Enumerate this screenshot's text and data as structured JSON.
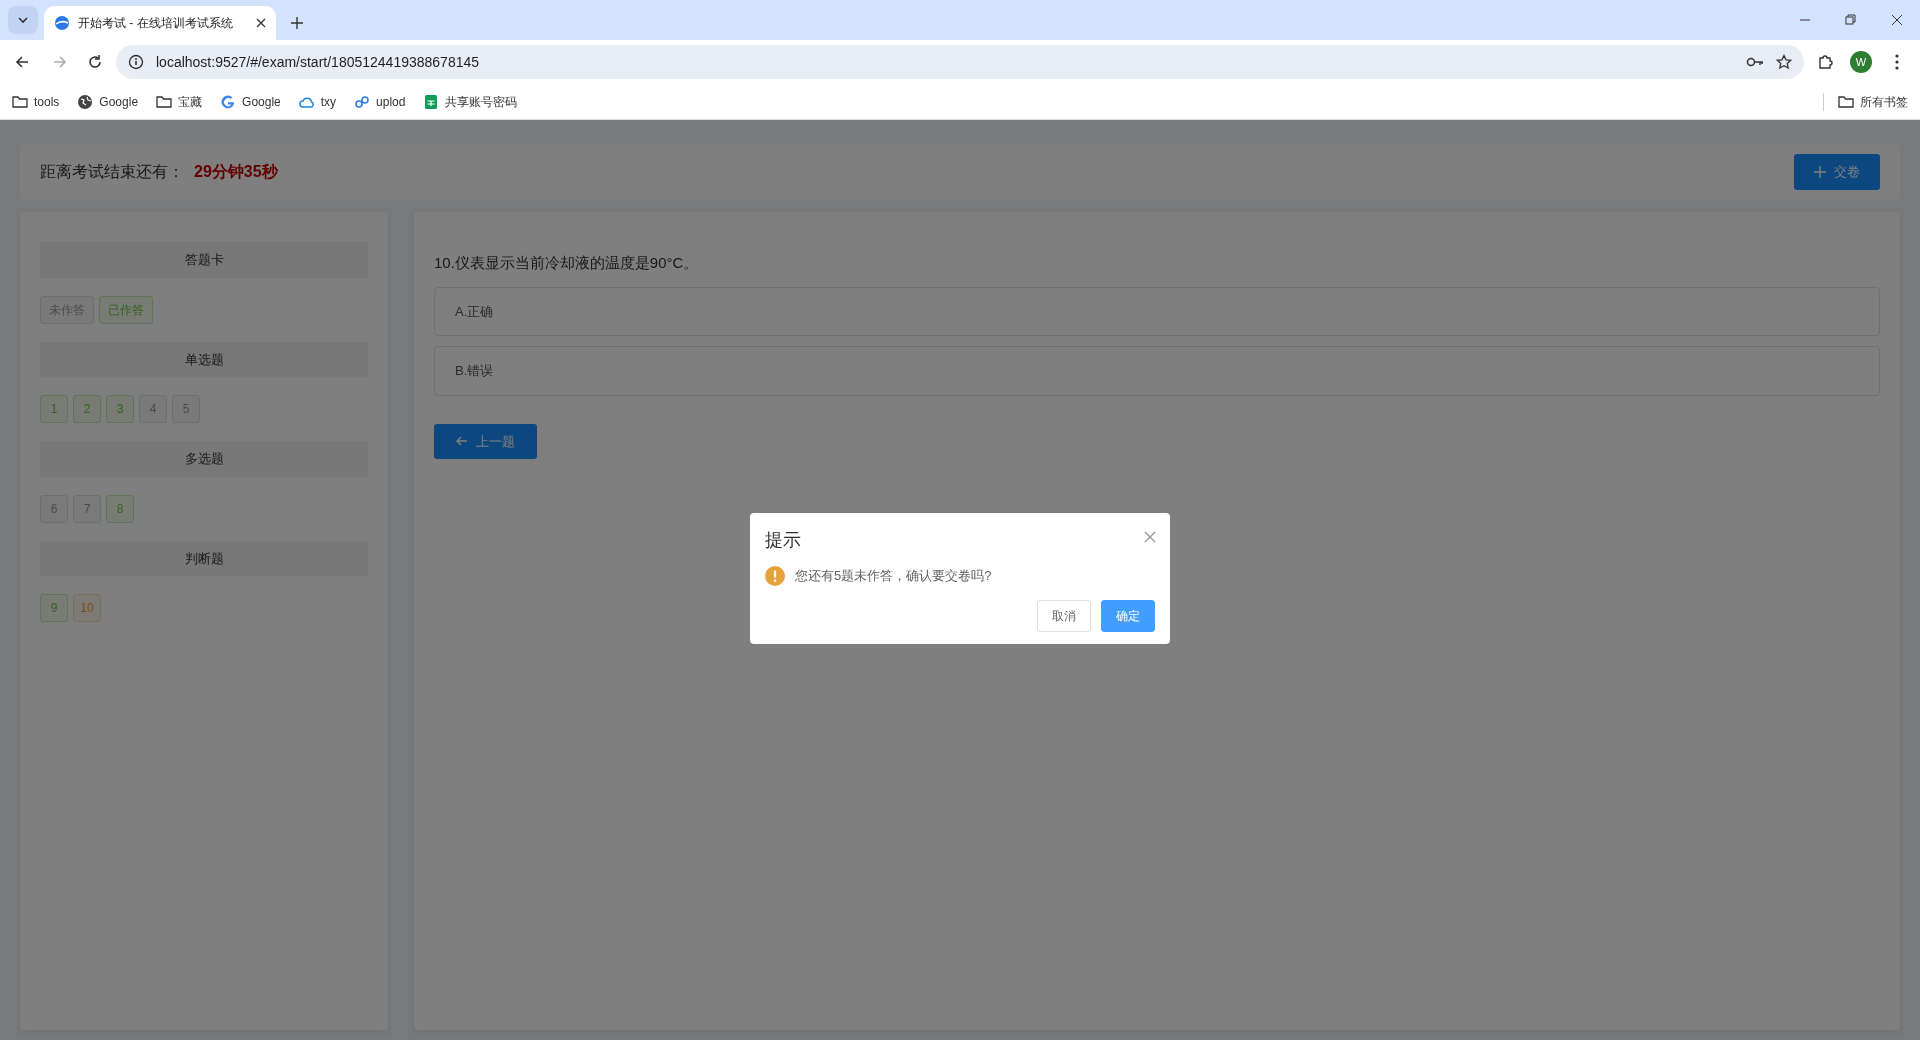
{
  "browser": {
    "tab_title": "开始考试 - 在线培训考试系统",
    "url": "localhost:9527/#/exam/start/1805124419388678145",
    "profile_initial": "W",
    "bookmarks": [
      {
        "kind": "folder",
        "label": "tools"
      },
      {
        "kind": "globe",
        "label": "Google"
      },
      {
        "kind": "folder",
        "label": "宝藏"
      },
      {
        "kind": "google",
        "label": "Google"
      },
      {
        "kind": "cloud",
        "label": "txy"
      },
      {
        "kind": "link",
        "label": "uplod"
      },
      {
        "kind": "sheet",
        "label": "共享账号密码"
      }
    ],
    "all_bookmarks": "所有书签"
  },
  "header": {
    "countdown_label": "距离考试结束还有：",
    "countdown": "29分钟35秒",
    "submit_button": "交卷"
  },
  "answer_card": {
    "title": "答题卡",
    "legend": [
      {
        "label": "未作答",
        "answered": false
      },
      {
        "label": "已作答",
        "answered": true
      }
    ],
    "groups": [
      {
        "title": "单选题",
        "items": [
          {
            "label": "1",
            "answered": true,
            "current": false
          },
          {
            "label": "2",
            "answered": true,
            "current": false
          },
          {
            "label": "3",
            "answered": true,
            "current": false
          },
          {
            "label": "4",
            "answered": false,
            "current": false
          },
          {
            "label": "5",
            "answered": false,
            "current": false
          }
        ]
      },
      {
        "title": "多选题",
        "items": [
          {
            "label": "6",
            "answered": false,
            "current": false
          },
          {
            "label": "7",
            "answered": false,
            "current": false
          },
          {
            "label": "8",
            "answered": true,
            "current": false
          }
        ]
      },
      {
        "title": "判断题",
        "items": [
          {
            "label": "9",
            "answered": true,
            "current": false
          },
          {
            "label": "10",
            "answered": false,
            "current": true
          }
        ]
      }
    ]
  },
  "question": {
    "text": "10.仪表显示当前冷却液的温度是90°C。",
    "options": [
      {
        "label": "A.正确",
        "selected": false
      },
      {
        "label": "B.错误",
        "selected": false
      }
    ],
    "prev_button": "上一题"
  },
  "dialog": {
    "title": "提示",
    "message": "您还有5题未作答，确认要交卷吗?",
    "cancel": "取消",
    "confirm": "确定"
  }
}
